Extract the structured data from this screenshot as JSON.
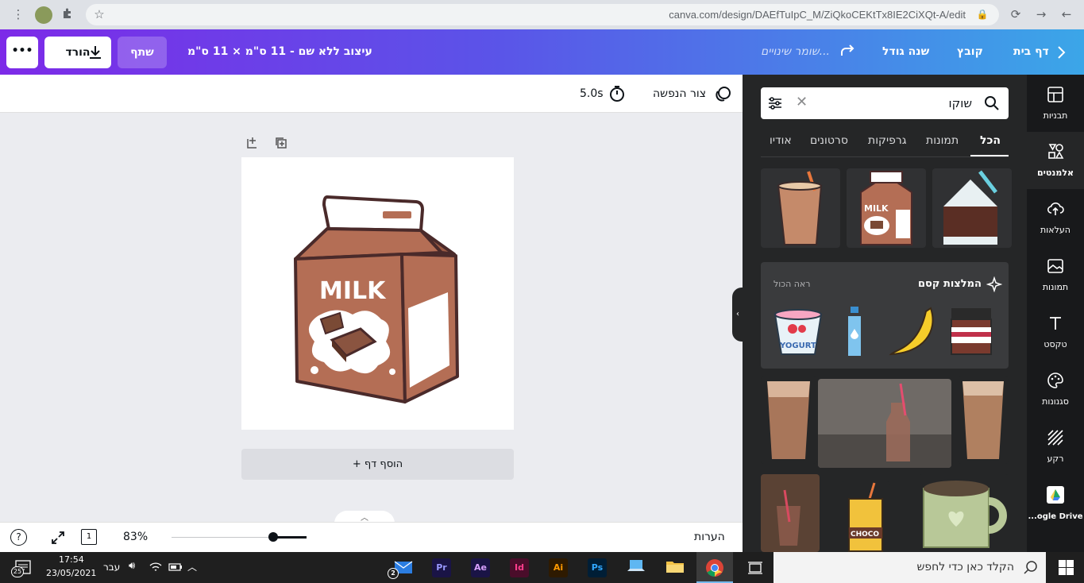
{
  "browser": {
    "url": "canva.com/design/DAEfTuIpC_M/ZiQkoCEKtTx8IE2CiXQt-A/edit"
  },
  "header": {
    "home": "דף בית",
    "file": "קובץ",
    "promo": "שנה גודל",
    "saving": "שומר שינויים...",
    "design_title": "עיצוב ללא שם - 11 ס\"מ × 11 ס\"מ",
    "share": "שתף",
    "download": "הורד",
    "more": "•••"
  },
  "toolbar": {
    "animate": "צור הנפשה",
    "duration": "5.0s"
  },
  "canvas": {
    "milk_text": "MILK",
    "add_page": "+ הוסף דף"
  },
  "footer": {
    "notes": "הערות",
    "zoom": "83%",
    "zoom_level": 0.75,
    "page_count": "1",
    "help": "?"
  },
  "panel": {
    "search_value": "שוקו",
    "tabs": [
      "הכל",
      "תמונות",
      "גרפיקות",
      "סרטונים",
      "אודיו"
    ],
    "magic_title": "המלצות קסם",
    "see_all": "ראה הכול",
    "milk_label": "MILK",
    "yogurt_label": "YOGURT",
    "choco_label": "CHOCO"
  },
  "rail": {
    "items": [
      "תבניות",
      "אלמנטים",
      "העלאות",
      "תמונות",
      "טקסט",
      "סגנונות",
      "רקע",
      "...ogle Drive"
    ]
  },
  "taskbar": {
    "search_placeholder": "הקלד כאן כדי לחפש",
    "time": "17:54",
    "date": "23/05/2021",
    "language": "עבר",
    "notifications": "25",
    "mail_badge": "2",
    "apps": [
      "Pr",
      "Ae",
      "Id",
      "Ai",
      "Ps"
    ]
  },
  "colors": {
    "header_start": "#7d2ae8",
    "header_end": "#3ba6e8",
    "panel_bg": "#252627",
    "rail_bg": "#18191b",
    "carton_brown": "#b46e55"
  }
}
